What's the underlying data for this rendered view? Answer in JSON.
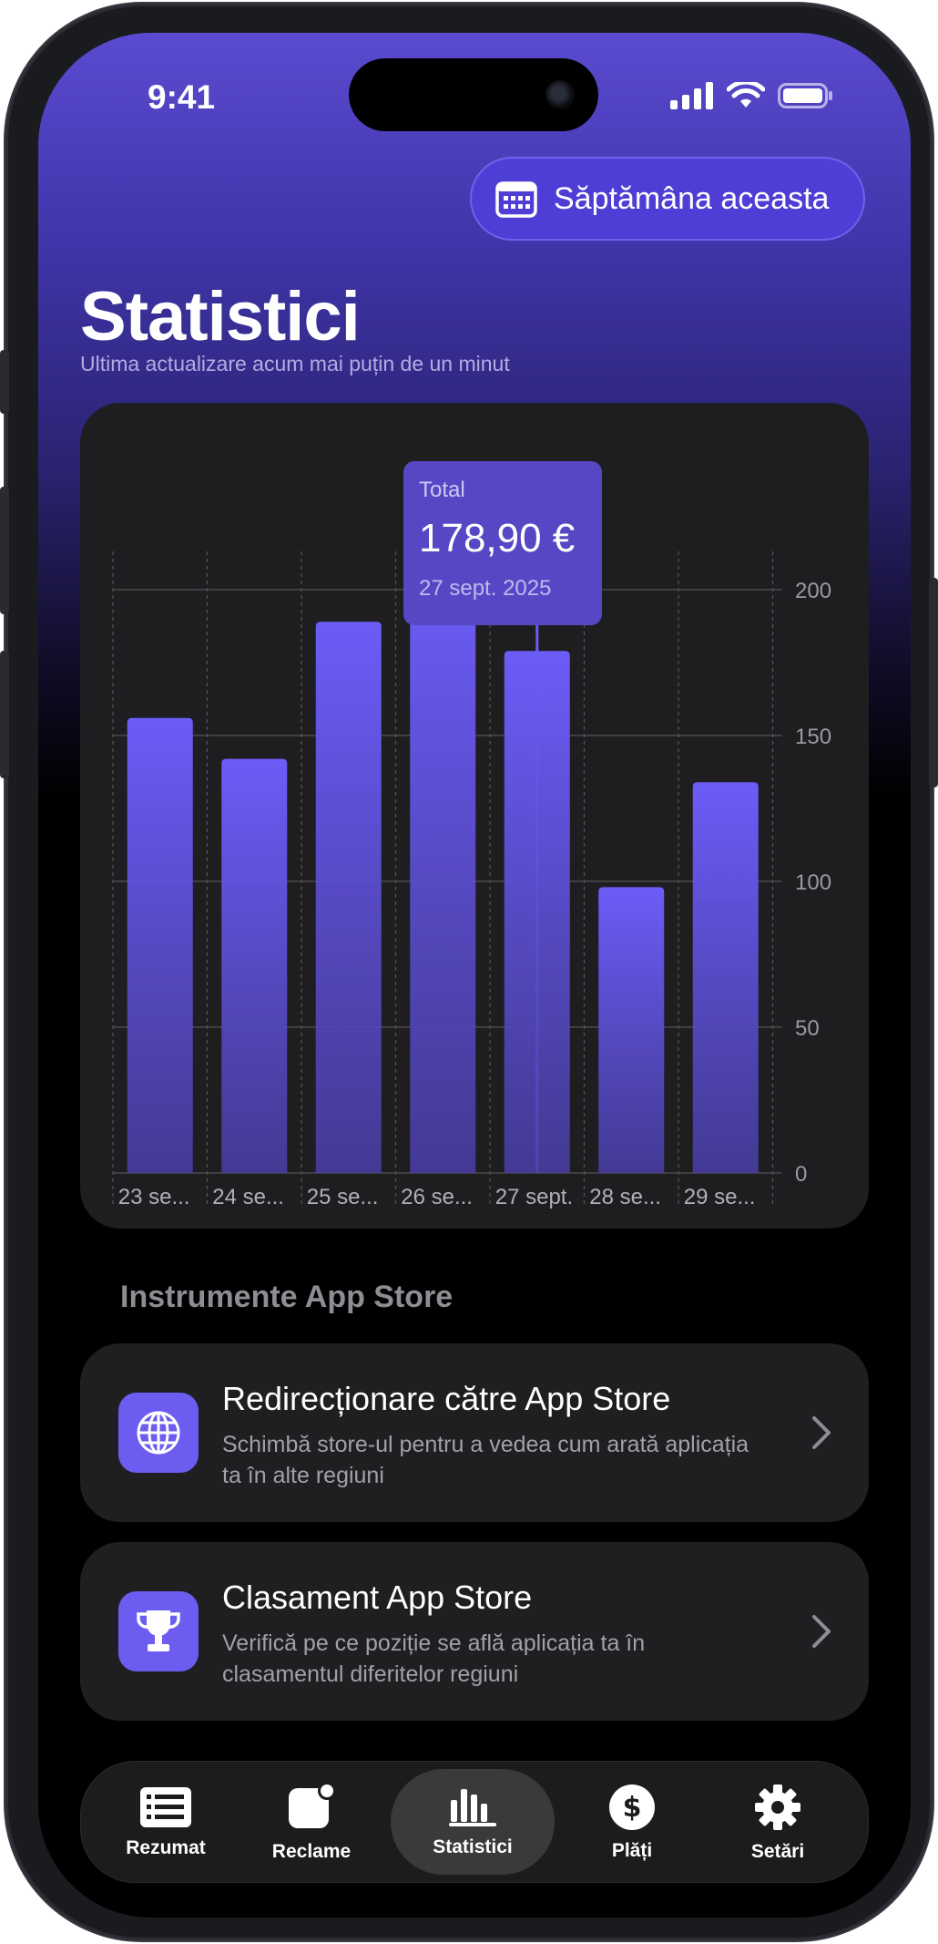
{
  "status": {
    "time": "9:41"
  },
  "period": {
    "label": "Săptămâna aceasta"
  },
  "header": {
    "title": "Statistici",
    "subtitle": "Ultima actualizare acum mai puțin de un minut"
  },
  "tooltip": {
    "label": "Total",
    "value": "178,90 €",
    "date": "27 sept. 2025"
  },
  "chart_data": {
    "type": "bar",
    "categories": [
      "23 se...",
      "24 se...",
      "25 se...",
      "26 se...",
      "27 sept.",
      "28 se...",
      "29 se..."
    ],
    "values": [
      156,
      142,
      189,
      204,
      179,
      98,
      134
    ],
    "yticks": [
      0,
      50,
      100,
      150,
      200
    ],
    "ylim": [
      0,
      220
    ],
    "selected_index": 4,
    "bar_color": "#6c5cf8",
    "title": "",
    "xlabel": "",
    "ylabel": ""
  },
  "tools": {
    "section_title": "Instrumente App Store",
    "items": [
      {
        "title": "Redirecționare către App Store",
        "description": "Schimbă store-ul pentru a vedea cum arată aplicația ta în alte regiuni",
        "icon": "globe-icon"
      },
      {
        "title": "Clasament App Store",
        "description": "Verifică pe ce poziție se află aplicația ta în clasamentul diferitelor regiuni",
        "icon": "trophy-icon"
      }
    ]
  },
  "tabs": [
    {
      "label": "Rezumat",
      "icon": "list-icon"
    },
    {
      "label": "Reclame",
      "icon": "notification-icon"
    },
    {
      "label": "Statistici",
      "icon": "bar-chart-icon",
      "active": true
    },
    {
      "label": "Plăți",
      "icon": "dollar-icon"
    },
    {
      "label": "Setări",
      "icon": "gear-icon"
    }
  ],
  "colors": {
    "accent": "#6c5cf0",
    "background": "#000000",
    "card": "#1e1e20"
  }
}
